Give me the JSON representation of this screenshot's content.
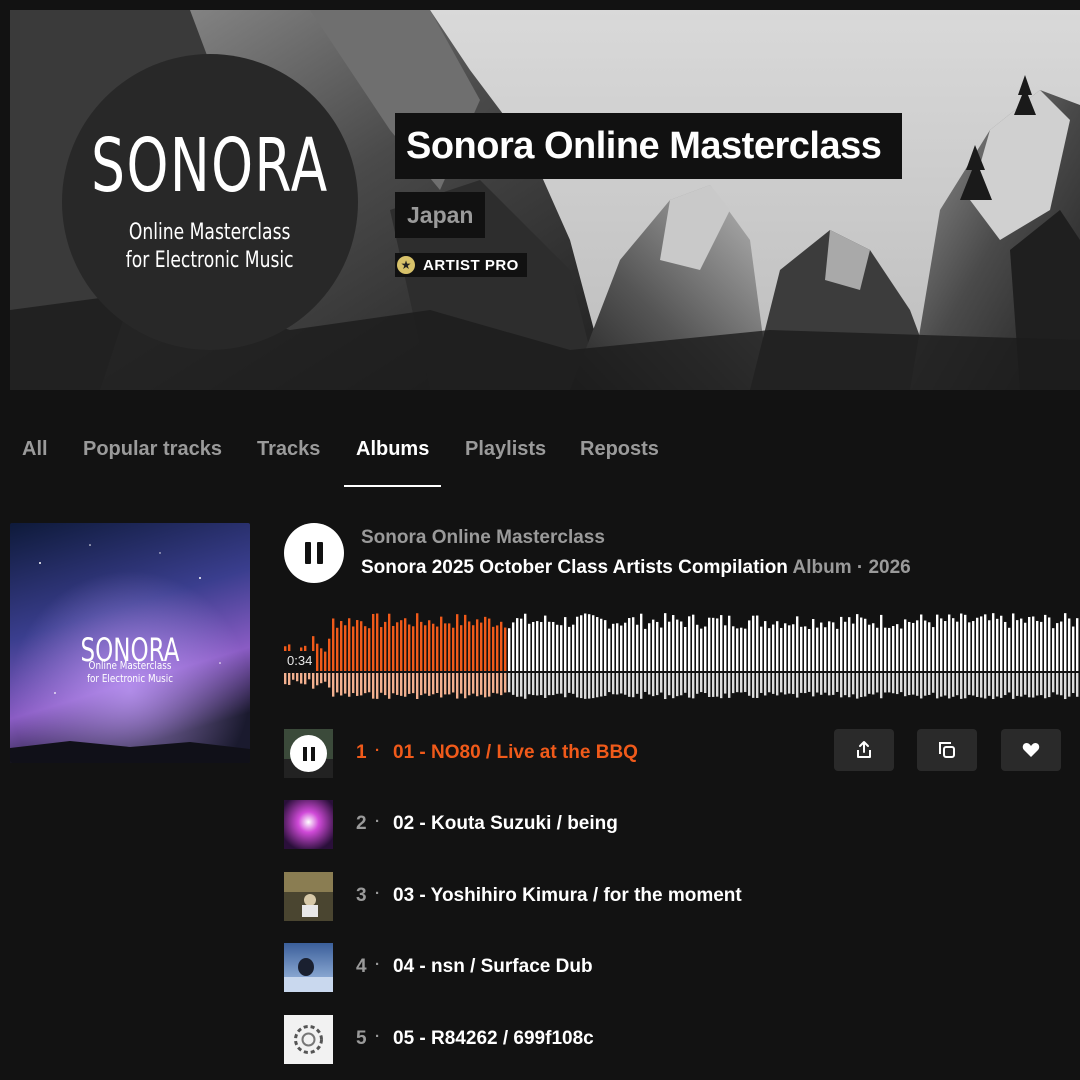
{
  "header": {
    "logo_word": "SONORA",
    "logo_sub_line1": "Online Masterclass",
    "logo_sub_line2": "for Electronic Music",
    "title": "Sonora Online Masterclass",
    "country": "Japan",
    "badge": "ARTIST PRO"
  },
  "tabs": [
    {
      "label": "All",
      "active": false
    },
    {
      "label": "Popular tracks",
      "active": false
    },
    {
      "label": "Tracks",
      "active": false
    },
    {
      "label": "Albums",
      "active": true
    },
    {
      "label": "Playlists",
      "active": false
    },
    {
      "label": "Reposts",
      "active": false
    }
  ],
  "album": {
    "art_word": "SONORA",
    "art_sub_line1": "Online Masterclass",
    "art_sub_line2": "for Electronic Music",
    "artist": "Sonora Online Masterclass",
    "title": "Sonora 2025 October Class Artists Compilation",
    "meta": "Album · 2026"
  },
  "player": {
    "state": "playing",
    "elapsed": "0:34",
    "progress": 0.28,
    "played_color": "#f05a1a",
    "played_reflection_color": "#f2b08f",
    "unplayed_color": "#ffffff"
  },
  "tracks": [
    {
      "num": "1",
      "title": "01 - NO80 / Live at the BBQ",
      "playing": true
    },
    {
      "num": "2",
      "title": "02 - Kouta Suzuki / being",
      "playing": false
    },
    {
      "num": "3",
      "title": "03 - Yoshihiro Kimura / for the moment",
      "playing": false
    },
    {
      "num": "4",
      "title": "04 - nsn / Surface Dub",
      "playing": false
    },
    {
      "num": "5",
      "title": "05 - R84262 / 699f108c",
      "playing": false
    }
  ],
  "track_actions": [
    {
      "icon": "share-icon"
    },
    {
      "icon": "copy-icon"
    },
    {
      "icon": "heart-icon"
    }
  ],
  "colors": {
    "accent": "#f05a1a",
    "background": "#121212",
    "muted_text": "#9a9a9a",
    "pro_badge": "#d8c26a"
  }
}
